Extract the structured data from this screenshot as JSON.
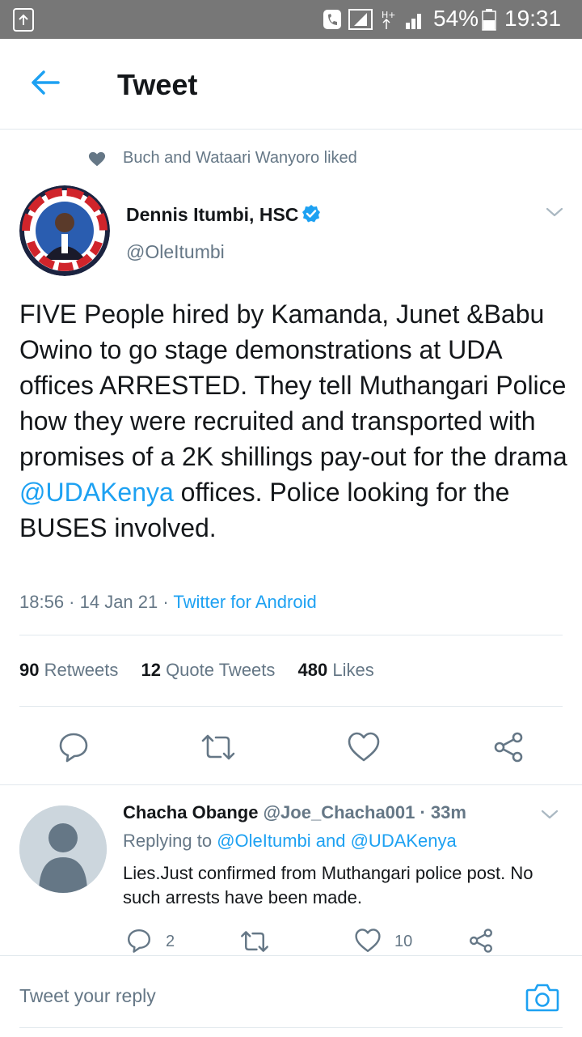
{
  "status_bar": {
    "battery": "54%",
    "time": "19:31"
  },
  "header": {
    "title": "Tweet",
    "back_icon": "arrow-left-icon"
  },
  "social_context": {
    "icon": "heart-icon",
    "text": "Buch and Wataari Wanyoro liked"
  },
  "tweet": {
    "author_name": "Dennis Itumbi, HSC",
    "author_handle": "@OleItumbi",
    "verified": true,
    "avatar_text": "I'VE GOT YOUR BACK",
    "text_before": "FIVE People hired by Kamanda, Junet &Babu Owino to go stage demonstrations at UDA offices ARRESTED. They tell Muthangari Police how they were recruited and transported  with promises of a 2K shillings pay-out for the drama ",
    "mention": "@UDAKenya",
    "text_after": " offices. Police looking for the BUSES involved.",
    "time": "18:56 · 14 Jan 21 · ",
    "source": "Twitter for Android",
    "stats": {
      "retweets_count": "90",
      "retweets_label": "Retweets",
      "quotes_count": "12",
      "quotes_label": "Quote Tweets",
      "likes_count": "480",
      "likes_label": "Likes"
    }
  },
  "reply": {
    "name": "Chacha Obange",
    "handle_time": "@Joe_Chacha001 · 33m",
    "replying_label": "Replying to ",
    "replying_to": "@OleItumbi and @UDAKenya",
    "text": "Lies.Just confirmed from Muthangari police post. No such arrests have been made.",
    "reply_count": "2",
    "like_count": "10"
  },
  "compose": {
    "placeholder": "Tweet your reply"
  },
  "colors": {
    "accent": "#1da1f2",
    "text": "#14171a",
    "muted": "#657786",
    "status_bar": "#777777"
  }
}
